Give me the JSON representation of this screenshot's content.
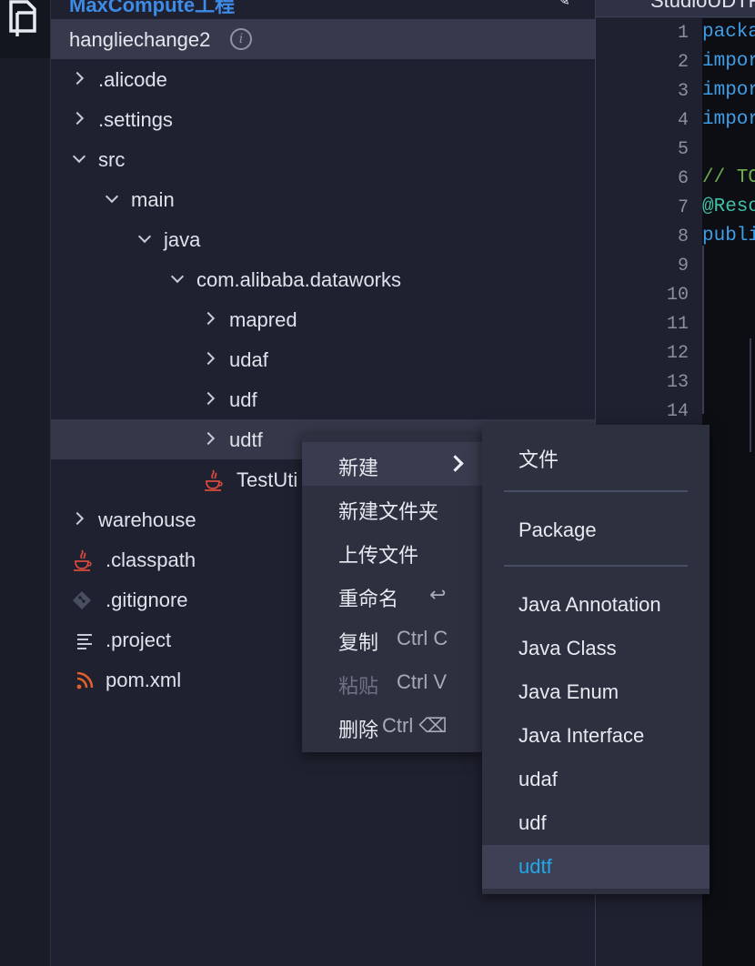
{
  "sidebar": {
    "header_title": "MaxCompute工程",
    "project_name": "hangliechange2",
    "tree": [
      {
        "label": ".alicode"
      },
      {
        "label": ".settings"
      },
      {
        "label": "src"
      },
      {
        "label": "main"
      },
      {
        "label": "java"
      },
      {
        "label": "com.alibaba.dataworks"
      },
      {
        "label": "mapred"
      },
      {
        "label": "udaf"
      },
      {
        "label": "udf"
      },
      {
        "label": "udtf"
      },
      {
        "label": "TestUti"
      },
      {
        "label": "warehouse"
      },
      {
        "label": ".classpath"
      },
      {
        "label": ".gitignore"
      },
      {
        "label": ".project"
      },
      {
        "label": "pom.xml"
      }
    ]
  },
  "editor": {
    "tab_title": "StudioUDTF",
    "line_numbers": [
      "1",
      "2",
      "3",
      "4",
      "5",
      "6",
      "7",
      "8",
      "9",
      "10",
      "11",
      "12",
      "13",
      "14"
    ],
    "code_lines": [
      "packa",
      "impor",
      "impor",
      "impor",
      "",
      "// TO",
      "@Reso",
      "publi"
    ]
  },
  "context_menu": {
    "items": [
      {
        "label": "新建",
        "shortcut": ""
      },
      {
        "label": "新建文件夹",
        "shortcut": ""
      },
      {
        "label": "上传文件",
        "shortcut": ""
      },
      {
        "label": "重命名",
        "shortcut": "↩"
      },
      {
        "label": "复制",
        "shortcut": "Ctrl C"
      },
      {
        "label": "粘贴",
        "shortcut": "Ctrl V"
      },
      {
        "label": "删除",
        "shortcut": "Ctrl ⌫"
      }
    ]
  },
  "submenu": {
    "items": [
      {
        "label": "文件"
      },
      {
        "label": "Package"
      },
      {
        "label": "Java Annotation"
      },
      {
        "label": "Java Class"
      },
      {
        "label": "Java Enum"
      },
      {
        "label": "Java Interface"
      },
      {
        "label": "udaf"
      },
      {
        "label": "udf"
      },
      {
        "label": "udtf"
      }
    ]
  },
  "colors": {
    "accent": "#22a7e8",
    "background": "#1d1f2b",
    "java_icon": "#d94b3c",
    "rss_icon": "#e0602a"
  }
}
